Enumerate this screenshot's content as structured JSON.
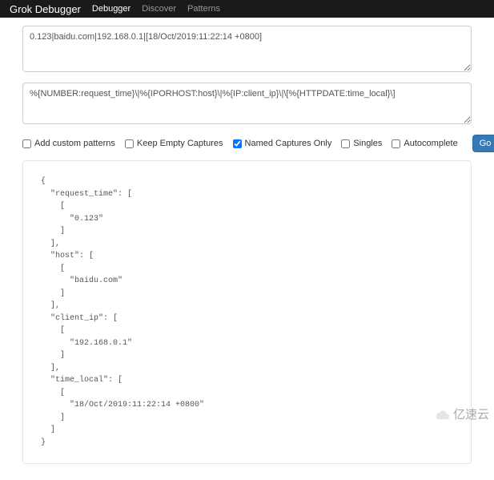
{
  "navbar": {
    "brand": "Grok Debugger",
    "items": [
      {
        "label": "Debugger",
        "active": true
      },
      {
        "label": "Discover",
        "active": false
      },
      {
        "label": "Patterns",
        "active": false
      }
    ]
  },
  "inputs": {
    "sample_text": "0.123|baidu.com|192.168.0.1|[18/Oct/2019:11:22:14 +0800]",
    "pattern_text": "%{NUMBER:request_time}\\|%{IPORHOST:host}\\|%{IP:client_ip}\\|\\[%{HTTPDATE:time_local}\\]"
  },
  "options": {
    "add_custom_patterns": {
      "label": "Add custom patterns",
      "checked": false
    },
    "keep_empty_captures": {
      "label": "Keep Empty Captures",
      "checked": false
    },
    "named_captures_only": {
      "label": "Named Captures Only",
      "checked": true
    },
    "singles": {
      "label": "Singles",
      "checked": false
    },
    "autocomplete": {
      "label": "Autocomplete",
      "checked": false
    }
  },
  "buttons": {
    "go": "Go"
  },
  "result_json": "{\n  \"request_time\": [\n    [\n      \"0.123\"\n    ]\n  ],\n  \"host\": [\n    [\n      \"baidu.com\"\n    ]\n  ],\n  \"client_ip\": [\n    [\n      \"192.168.0.1\"\n    ]\n  ],\n  \"time_local\": [\n    [\n      \"18/Oct/2019:11:22:14 +0800\"\n    ]\n  ]\n}",
  "watermark": {
    "text": "亿速云"
  }
}
